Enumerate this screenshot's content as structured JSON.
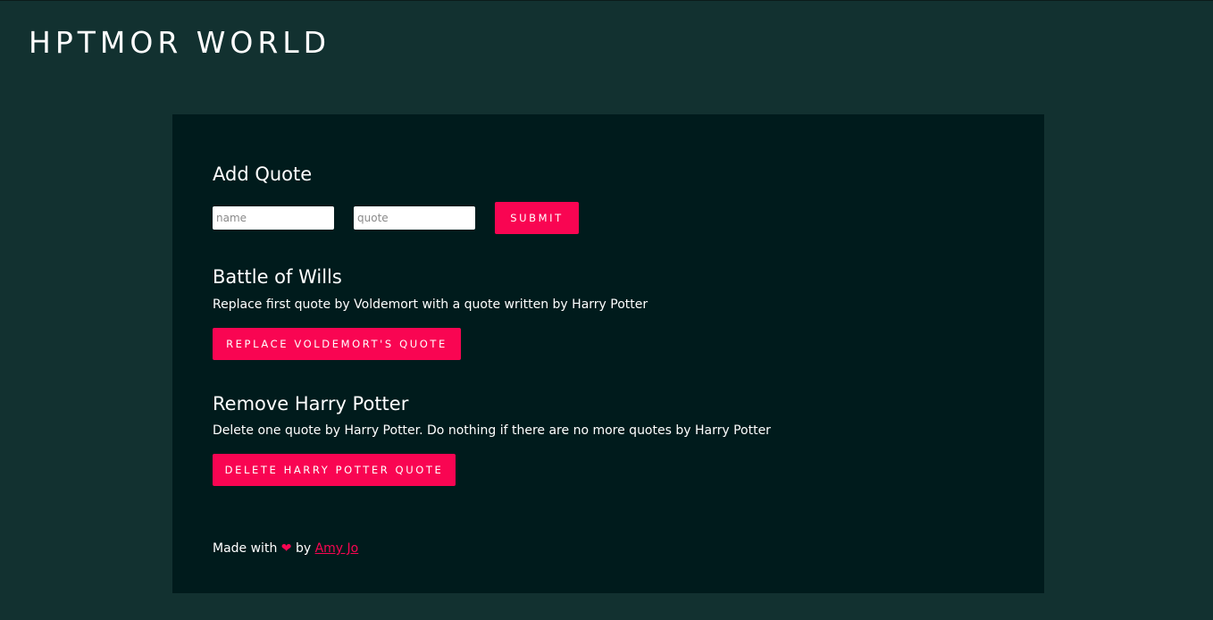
{
  "header": {
    "site_title": "HPTMOR WORLD"
  },
  "add_quote": {
    "title": "Add Quote",
    "name_placeholder": "name",
    "quote_placeholder": "quote",
    "submit_label": "SUBMIT"
  },
  "battle_of_wills": {
    "title": "Battle of Wills",
    "description": "Replace first quote by Voldemort with a quote written by Harry Potter",
    "button_label": "REPLACE VOLDEMORT'S QUOTE"
  },
  "remove_harry": {
    "title": "Remove Harry Potter",
    "description": "Delete one quote by Harry Potter. Do nothing if there are no more quotes by Harry Potter",
    "button_label": "DELETE HARRY POTTER QUOTE"
  },
  "footer": {
    "made_with": "Made with",
    "heart_icon": "❤",
    "by": "by",
    "author": "Amy Jo"
  },
  "colors": {
    "page_background": "#123130",
    "panel_background": "#001b1c",
    "accent": "#f90552",
    "text": "#ffffff"
  }
}
